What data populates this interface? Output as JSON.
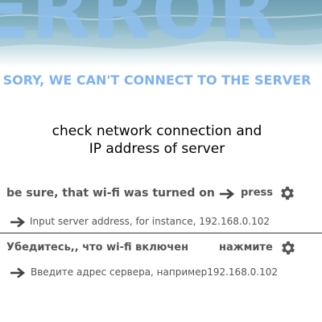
{
  "hero": {
    "word": "ERROR"
  },
  "message": {
    "sorry": "SORY, WE CAN'T CONNECT TO THE SERVER",
    "check_line1": "check network connection and",
    "check_line2": "IP address of server"
  },
  "english": {
    "wifi_text": "be sure, that wi-fi was turned on",
    "press_text": "press",
    "server_hint": "Input server address, for instance, 192.168.0.102"
  },
  "russian": {
    "wifi_text": "Убедитесь,, что wi-fi включен",
    "press_text": "нажмите",
    "server_hint": "Введите адрес сервера, например192.168.0.102"
  },
  "colors": {
    "accent": "#7fb2ee",
    "text_gray": "#555555",
    "hero_blue": "#8fc0ee"
  },
  "icons": {
    "arrow": "arrow-right-icon",
    "gear": "gear-icon"
  }
}
